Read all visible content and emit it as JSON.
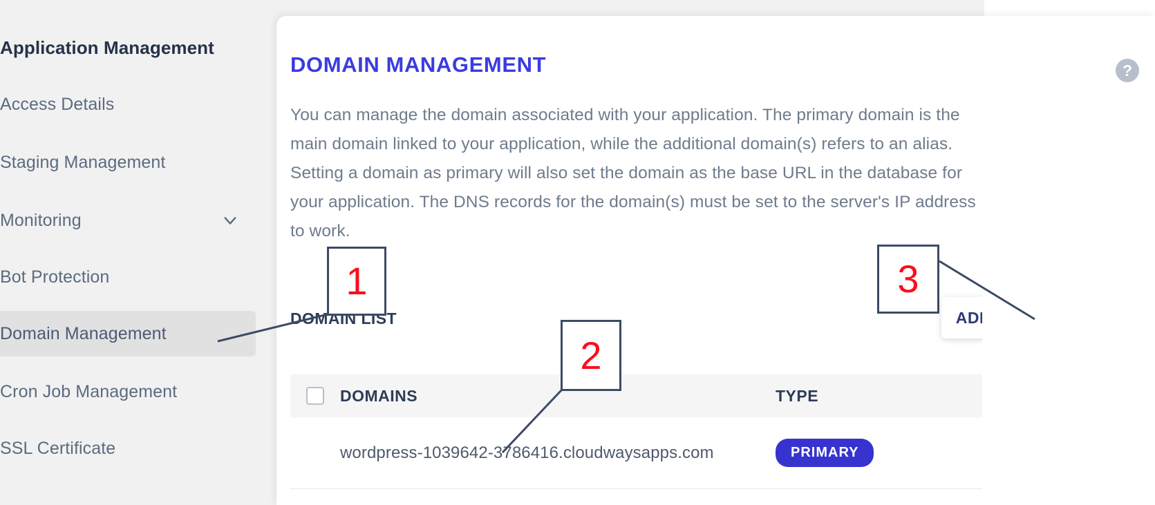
{
  "sidebar": {
    "items": [
      {
        "label": "Application Management",
        "type": "title",
        "active": false,
        "chevron": false
      },
      {
        "label": "Access Details",
        "type": "item",
        "active": false,
        "chevron": false
      },
      {
        "label": "Staging Management",
        "type": "item",
        "active": false,
        "chevron": false
      },
      {
        "label": "Monitoring",
        "type": "item",
        "active": false,
        "chevron": true
      },
      {
        "label": "Bot Protection",
        "type": "item",
        "active": false,
        "chevron": false
      },
      {
        "label": "Domain Management",
        "type": "item",
        "active": true,
        "chevron": false
      },
      {
        "label": "Cron Job Management",
        "type": "item",
        "active": false,
        "chevron": false
      },
      {
        "label": "SSL Certificate",
        "type": "item",
        "active": false,
        "chevron": false
      }
    ]
  },
  "main": {
    "title": "DOMAIN MANAGEMENT",
    "description": "You can manage the domain associated with your application. The primary domain is the main domain linked to your application, while the additional domain(s) refers to an alias. Setting a domain as primary will also set the domain as the base URL in the database for your application. The DNS records for the domain(s) must be set to the server's IP address to work.",
    "domain_list_label": "DOMAIN LIST",
    "add_domain_label": "ADD DOMAIN",
    "help_icon": "help-question-icon",
    "help_glyph": "?"
  },
  "table": {
    "columns": [
      "DOMAINS",
      "TYPE"
    ],
    "select_all_checked": false,
    "rows": [
      {
        "domain": "wordpress-1039642-3786416.cloudwaysapps.com",
        "type": "PRIMARY",
        "checked": false
      }
    ]
  },
  "annotations": [
    {
      "id": "1",
      "label": "1",
      "target": "sidebar-item-domain-management"
    },
    {
      "id": "2",
      "label": "2",
      "target": "domain-name-cell"
    },
    {
      "id": "3",
      "label": "3",
      "target": "add-domain-button"
    }
  ],
  "colors": {
    "title_blue": "#3a3ce0",
    "badge_blue": "#3733cf",
    "annotation_red": "#fc0d1b",
    "annotation_border": "#3c4a63",
    "sidebar_bg": "#f1f1f1",
    "active_item_bg": "#e1e1e1"
  }
}
